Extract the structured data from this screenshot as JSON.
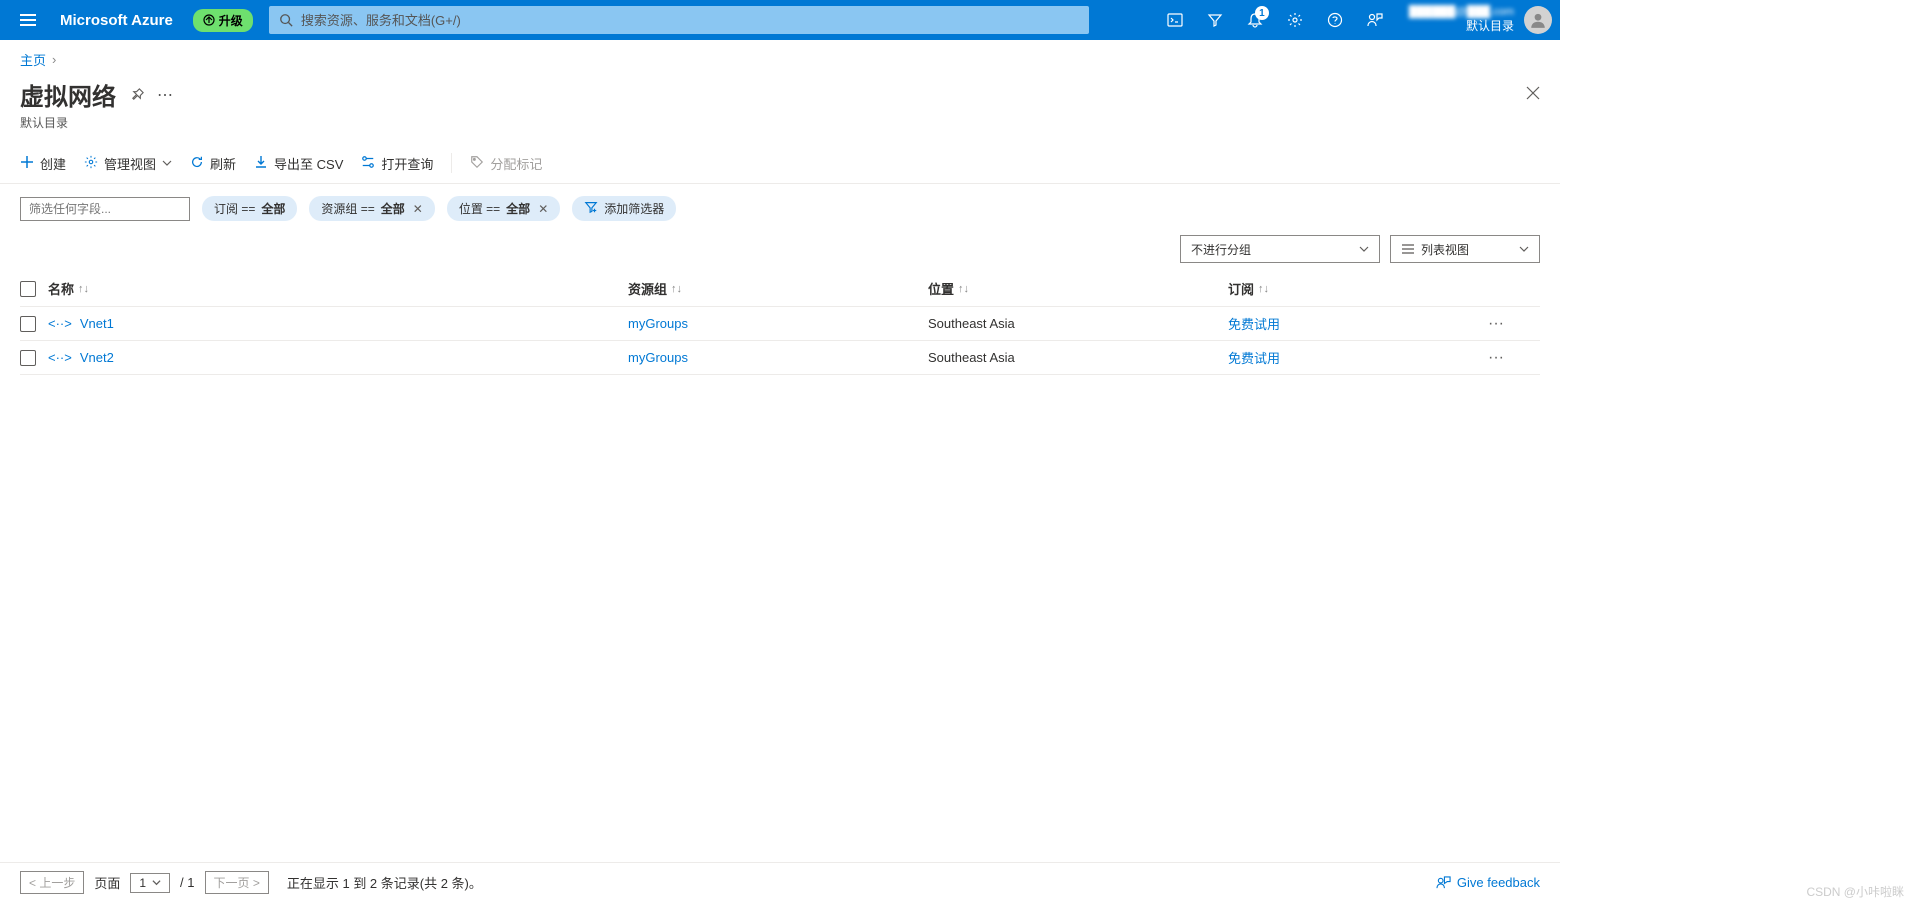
{
  "header": {
    "brand": "Microsoft Azure",
    "upgrade": "升级",
    "search_placeholder": "搜索资源、服务和文档(G+/)",
    "notification_count": "1",
    "directory_label": "默认目录"
  },
  "breadcrumb": {
    "home": "主页"
  },
  "page": {
    "title": "虚拟网络",
    "subtitle": "默认目录"
  },
  "toolbar": {
    "create": "创建",
    "manage_view": "管理视图",
    "refresh": "刷新",
    "export_csv": "导出至 CSV",
    "open_query": "打开查询",
    "assign_tags": "分配标记"
  },
  "filters": {
    "placeholder": "筛选任何字段...",
    "sub_label": "订阅 == ",
    "sub_value": "全部",
    "rg_label": "资源组 == ",
    "rg_value": "全部",
    "loc_label": "位置 == ",
    "loc_value": "全部",
    "add_filter": "添加筛选器"
  },
  "view": {
    "group_by": "不进行分组",
    "list_view": "列表视图"
  },
  "table": {
    "headers": {
      "name": "名称",
      "rg": "资源组",
      "location": "位置",
      "subscription": "订阅"
    },
    "rows": [
      {
        "name": "Vnet1",
        "rg": "myGroups",
        "location": "Southeast Asia",
        "subscription": "免费试用"
      },
      {
        "name": "Vnet2",
        "rg": "myGroups",
        "location": "Southeast Asia",
        "subscription": "免费试用"
      }
    ]
  },
  "pagination": {
    "prev": "< 上一步",
    "page_label": "页面",
    "current_page": "1",
    "total_pages": "/ 1",
    "next": "下一页 >",
    "status": "正在显示 1 到 2 条记录(共 2 条)。"
  },
  "feedback": "Give feedback",
  "watermark": "CSDN @小咔啦眯"
}
